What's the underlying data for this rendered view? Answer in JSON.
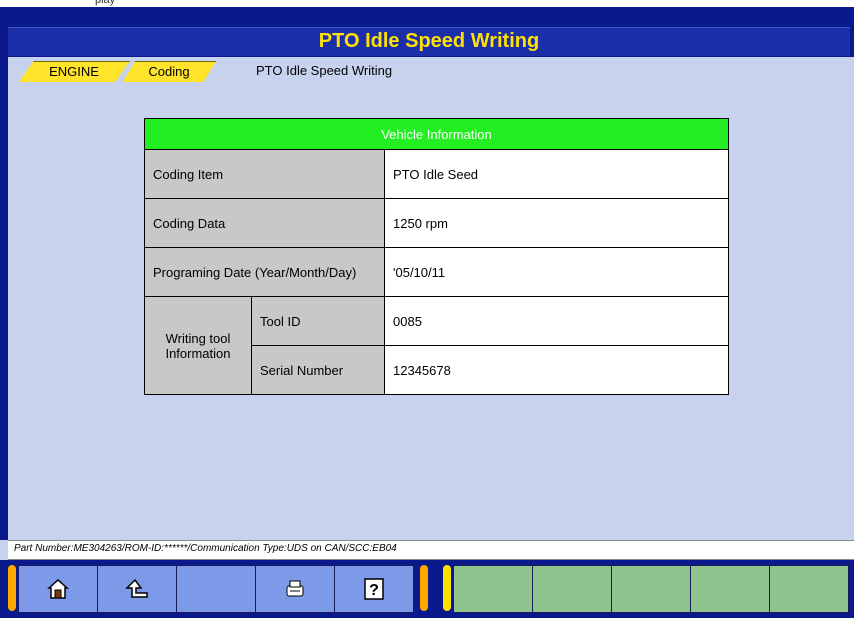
{
  "title": "PTO Idle Speed Writing",
  "breadcrumb": {
    "items": [
      "ENGINE",
      "Coding",
      "PTO Idle Speed Writing"
    ]
  },
  "table": {
    "header": "Vehicle Information",
    "rows": [
      {
        "label": "Coding Item",
        "value": "PTO Idle Seed"
      },
      {
        "label": "Coding Data",
        "value": "1250 rpm"
      },
      {
        "label": "Programing Date (Year/Month/Day)",
        "value": "'05/10/11"
      }
    ],
    "writing_tool": {
      "label": "Writing tool Information",
      "items": [
        {
          "label": "Tool ID",
          "value": "0085"
        },
        {
          "label": "Serial Number",
          "value": "12345678"
        }
      ]
    }
  },
  "status": "Part Number:ME304263/ROM-ID:******/Communication Type:UDS on CAN/SCC:EB04",
  "toolbar": {
    "buttons": [
      "home-icon",
      "back-icon",
      "",
      "print-icon",
      "help-icon"
    ],
    "help_label": "?"
  },
  "top_text": "play",
  "colors": {
    "title": "#ffe000",
    "header": "#22ee22"
  }
}
